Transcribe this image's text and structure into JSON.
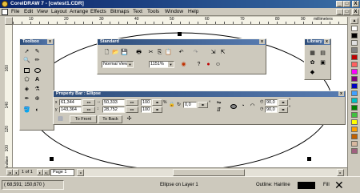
{
  "titlebar": {
    "title": "CorelDRAW 7 - [cwtest1.CDR]",
    "controls": [
      "_",
      "□",
      "X"
    ]
  },
  "menubar": {
    "items": [
      "File",
      "Edit",
      "View",
      "Layout",
      "Arrange",
      "Effects",
      "Bitmaps",
      "Text",
      "Tools",
      "Window",
      "Help"
    ],
    "doc_controls": [
      "_",
      "□",
      "X"
    ]
  },
  "ruler": {
    "ticks": [
      "10",
      "20",
      "30",
      "40",
      "50",
      "60",
      "70",
      "80",
      "90"
    ],
    "unit": "millimeters",
    "vertical_ticks": [
      "160",
      "140",
      "120",
      "100"
    ],
    "vertical_unit": "millimeters"
  },
  "toolbox": {
    "title": "Toolbox"
  },
  "standard": {
    "title": "Standard",
    "view_select": "Normal View",
    "zoom": "1151%"
  },
  "library": {
    "title": "Library"
  },
  "property_bar": {
    "title": "Property Bar : Ellipse",
    "x": "61,344",
    "y": "143,364",
    "w": "50,333",
    "h": "28,752",
    "scale_w": "100",
    "scale_h": "100",
    "unit_pct": "%",
    "rotation": "0,0",
    "start_angle": "90,0",
    "end_angle": "90,0",
    "degree": "°",
    "to_front": "To Front",
    "to_back": "To Back"
  },
  "pages": {
    "label": "1 of 1",
    "tab": "Page 1"
  },
  "status": {
    "coords": "( 68,591; 150,670 )",
    "object": "Ellipse on Layer 1",
    "outline": "Outline: Hairline",
    "fill": "Fill"
  },
  "palette": {
    "colors": [
      "#ffffff",
      "#000000",
      "#e0e0e0",
      "#808080",
      "#c00000",
      "#ff6060",
      "#ff00ff",
      "#800080",
      "#0000c0",
      "#40a0ff",
      "#00c0c0",
      "#008000",
      "#40c040",
      "#ffff00",
      "#ffa000",
      "#c06000",
      "#d8b8a0",
      "#a06080"
    ]
  },
  "colors": {
    "titlebar": "#0a246a",
    "workspace": "#ffffff",
    "chrome": "#cdc9bd"
  }
}
